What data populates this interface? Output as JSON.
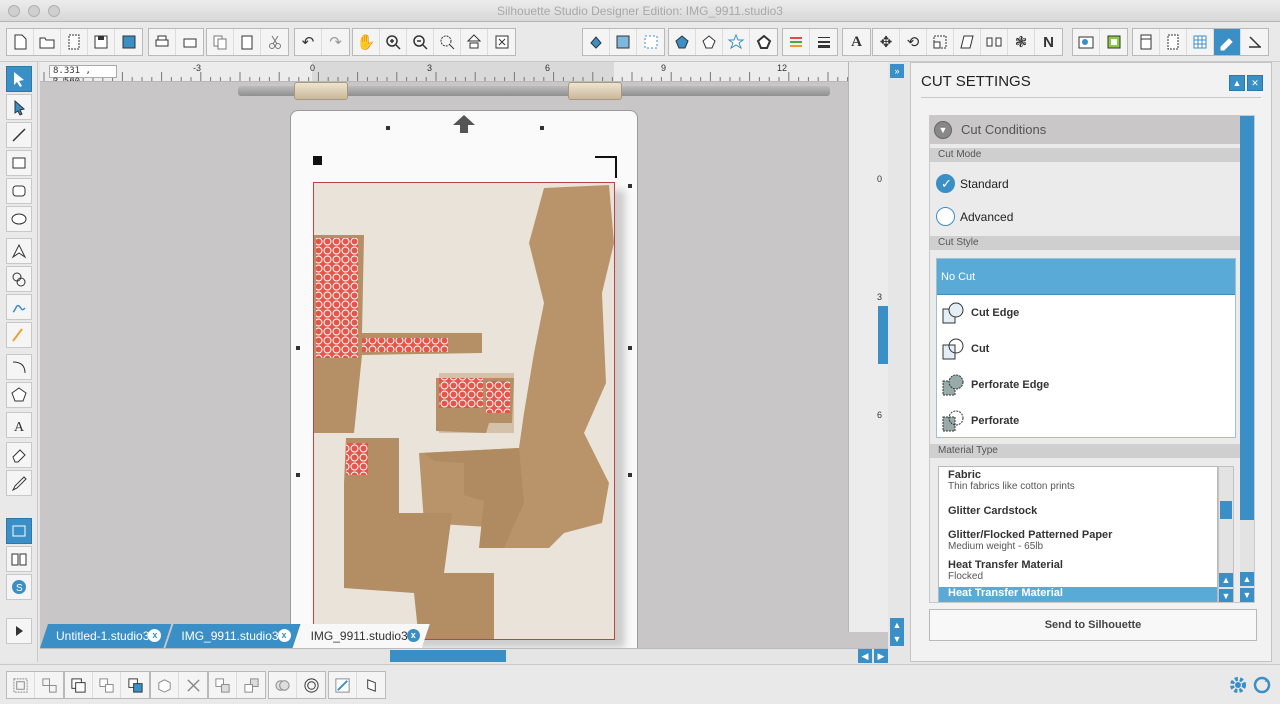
{
  "window": {
    "title": "Silhouette Studio Designer Edition: IMG_9911.studio3"
  },
  "canvas": {
    "coordinate_readout": "8.331 , 3.560",
    "ruler_top_labels": [
      "-3",
      "0",
      "3",
      "6",
      "9",
      "12"
    ],
    "ruler_right_labels": [
      "0",
      "3",
      "6"
    ]
  },
  "tabs": [
    {
      "label": "Untitled-1.studio3",
      "active": false
    },
    {
      "label": "IMG_9911.studio3",
      "active": false
    },
    {
      "label": "IMG_9911.studio3",
      "active": true
    }
  ],
  "panel": {
    "title": "CUT SETTINGS",
    "section_title": "Cut Conditions",
    "cut_mode": {
      "label": "Cut Mode",
      "options": [
        "Standard",
        "Advanced"
      ],
      "selected": "Standard"
    },
    "cut_style": {
      "label": "Cut Style",
      "options": [
        "No Cut",
        "Cut Edge",
        "Cut",
        "Perforate Edge",
        "Perforate"
      ],
      "selected": "No Cut"
    },
    "material_type": {
      "label": "Material Type",
      "items": [
        {
          "name": "Fabric",
          "desc": "Thin fabrics like cotton prints"
        },
        {
          "name": "Glitter Cardstock",
          "desc": ""
        },
        {
          "name": "Glitter/Flocked Patterned Paper",
          "desc": "Medium weight - 65lb"
        },
        {
          "name": "Heat Transfer Material",
          "desc": "Flocked"
        },
        {
          "name": "Heat Transfer Material",
          "desc": ""
        }
      ],
      "selected_index": 4
    },
    "send_button": "Send to Silhouette"
  },
  "icons": {
    "toolbar": [
      "new-file-icon",
      "open-icon",
      "new-page-icon",
      "save-icon",
      "save-to-library-icon",
      "print-icon",
      "print-cut-icon",
      "copy-icon",
      "paste-icon",
      "cut-icon",
      "undo-icon",
      "redo-icon",
      "pan-icon",
      "zoom-in-icon",
      "zoom-out-icon",
      "zoom-select-icon",
      "zoom-fit-icon",
      "fit-page-icon",
      "fill-color-icon",
      "gradient-icon",
      "pattern-icon",
      "line-color-icon",
      "line-style-icon",
      "shadow-icon",
      "offset-icon",
      "page-color-icon",
      "line-thickness-icon",
      "text-icon",
      "transform-icon",
      "rotate-icon",
      "scale-icon",
      "shear-icon",
      "align-icon",
      "replicate-icon",
      "nest-icon",
      "library-icon",
      "store-icon",
      "send-icon",
      "page-setup-icon",
      "registration-icon",
      "grid-icon",
      "cut-settings-icon",
      "trace-icon"
    ],
    "accent": "#3a8fc6"
  }
}
